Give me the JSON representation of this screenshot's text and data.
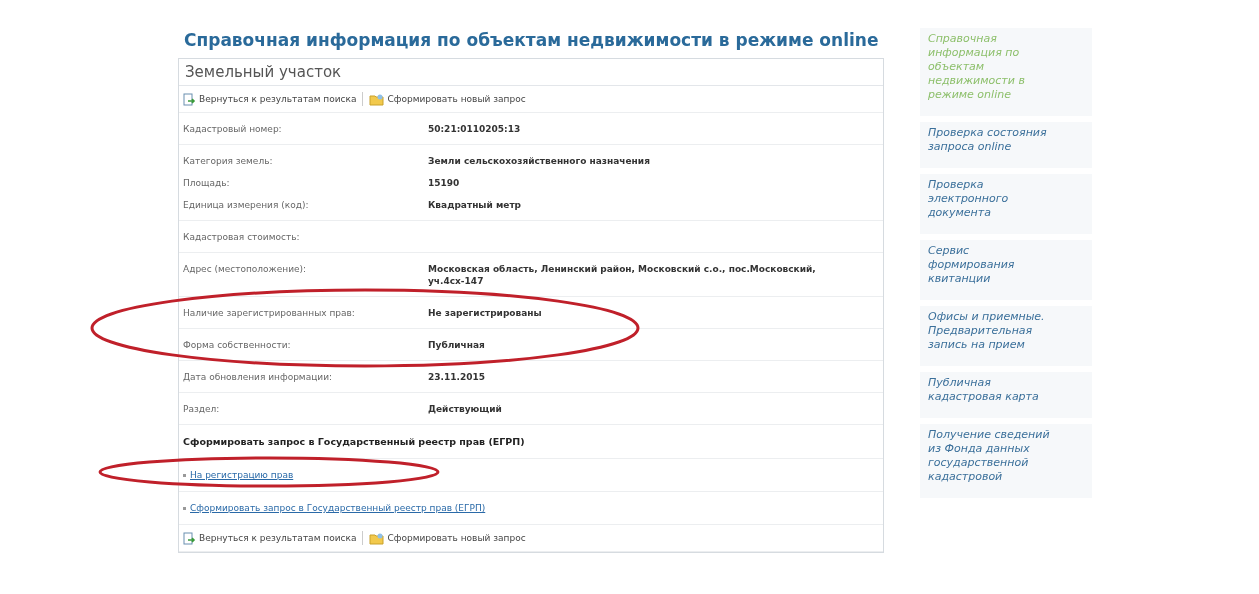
{
  "page_title": "Справочная информация по объектам недвижимости в режиме online",
  "panel": {
    "title": "Земельный участок",
    "toolbar_top": [
      {
        "kind": "back",
        "label": "Вернуться к результатам поиска"
      },
      {
        "kind": "new",
        "label": "Сформировать новый запрос"
      }
    ],
    "groups": [
      [
        {
          "label": "Кадастровый номер:",
          "value": "50:21:0110205:13"
        }
      ],
      [
        {
          "label": "Категория земель:",
          "value": "Земли сельскохозяйственного назначения"
        },
        {
          "label": "Площадь:",
          "value": "15190"
        },
        {
          "label": "Единица измерения (код):",
          "value": "Квадратный метр"
        }
      ],
      [
        {
          "label": "Кадастровая стоимость:"
        }
      ],
      [
        {
          "label": "Адрес (местоположение):",
          "value": "Московская область, Ленинский район, Московский с.о., пос.Московский, уч.4сх-147"
        }
      ],
      [
        {
          "label": "Наличие зарегистрированных прав:",
          "value": "Не зарегистрированы"
        }
      ],
      [
        {
          "label": "Форма собственности:",
          "value": "Публичная"
        }
      ],
      [
        {
          "label": "Дата обновления информации:",
          "value": "23.11.2015"
        }
      ],
      [
        {
          "label": "Раздел:",
          "value": "Действующий"
        }
      ]
    ],
    "section_heading": "Сформировать запрос в Государственный реестр прав (ЕГРП)",
    "links": [
      "На регистрацию прав",
      "Сформировать запрос в Государственный реестр прав (ЕГРП)"
    ],
    "toolbar_bottom": [
      {
        "kind": "back",
        "label": "Вернуться к результатам поиска"
      },
      {
        "kind": "new",
        "label": "Сформировать новый запрос"
      }
    ]
  },
  "sidebar": {
    "items": [
      {
        "label": "Справочная информация по объектам недвижимости в режиме online",
        "selected": true
      },
      {
        "label": "Проверка состояния запроса online",
        "selected": false
      },
      {
        "label": "Проверка электронного документа",
        "selected": false
      },
      {
        "label": "Сервис формирования квитанции",
        "selected": false
      },
      {
        "label": "Офисы и приемные. Предварительная запись на прием",
        "selected": false
      },
      {
        "label": "Публичная кадастровая карта",
        "selected": false
      },
      {
        "label": "Получение сведений из Фонда данных государственной кадастровой",
        "selected": false
      }
    ]
  }
}
